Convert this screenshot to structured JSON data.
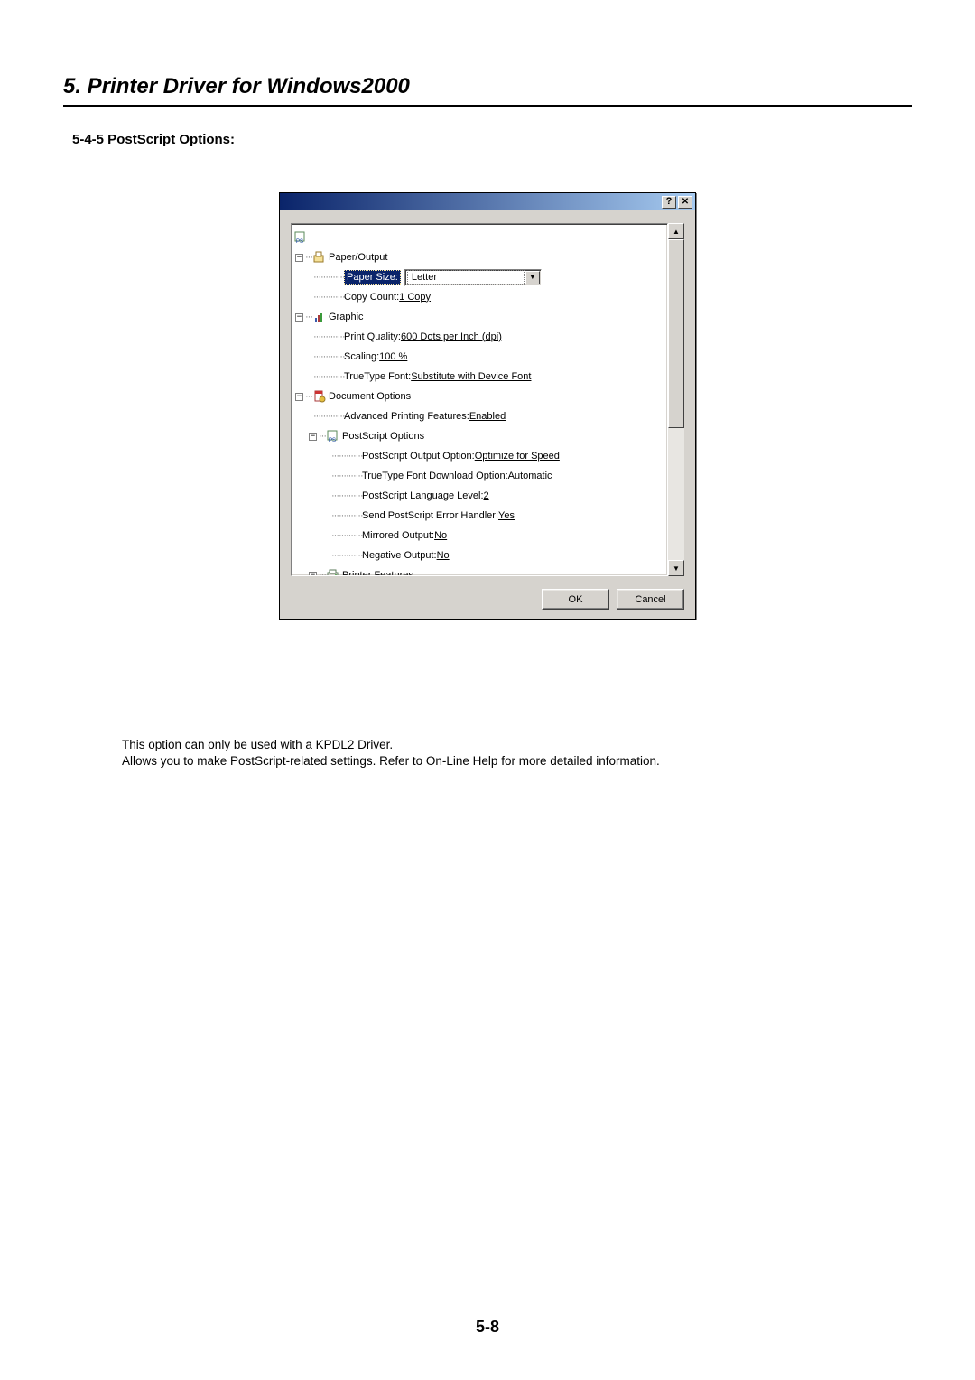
{
  "heading": "5. Printer Driver for Windows2000",
  "subheading": "5-4-5 PostScript Options:",
  "dialog": {
    "help_btn": "?",
    "close_btn": "✕",
    "tree": {
      "paper_output": "Paper/Output",
      "paper_size_label": "Paper Size:",
      "paper_size_value": "Letter",
      "copy_count_label": "Copy Count: ",
      "copy_count_value": "1 Copy",
      "graphic": "Graphic",
      "print_quality_label": "Print Quality: ",
      "print_quality_value": "600 Dots per Inch (dpi)",
      "scaling_label": "Scaling: ",
      "scaling_value": "100 %",
      "truetype_label": "TrueType Font: ",
      "truetype_value": "Substitute with Device Font",
      "doc_options": "Document Options",
      "adv_print_label": "Advanced Printing Features: ",
      "adv_print_value": "Enabled",
      "ps_options": "PostScript Options",
      "ps_output_label": "PostScript Output Option: ",
      "ps_output_value": "Optimize for Speed",
      "tt_download_label": "TrueType Font Download Option: ",
      "tt_download_value": "Automatic",
      "ps_lang_label": "PostScript Language Level: ",
      "ps_lang_value": "2",
      "ps_err_label": "Send PostScript Error Handler: ",
      "ps_err_value": "Yes",
      "mirrored_label": "Mirrored Output: ",
      "mirrored_value": "No",
      "negative_label": "Negative Output: ",
      "negative_value": "No",
      "printer_features": "Printer Features"
    },
    "ok": "OK",
    "cancel": "Cancel"
  },
  "note_line1": "This option can only be used with a KPDL2 Driver.",
  "note_line2": "Allows you to make PostScript-related settings. Refer to On-Line Help for more detailed information.",
  "page_num": "5-8"
}
